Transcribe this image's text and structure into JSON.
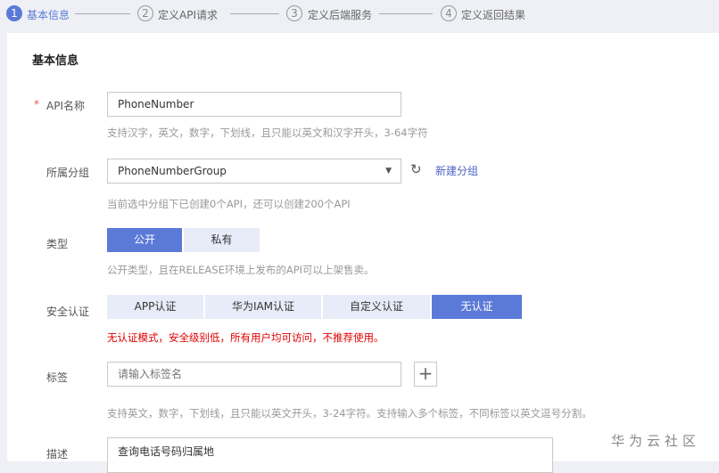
{
  "steps": [
    {
      "num": "1",
      "label": "基本信息"
    },
    {
      "num": "2",
      "label": "定义API请求"
    },
    {
      "num": "3",
      "label": "定义后端服务"
    },
    {
      "num": "4",
      "label": "定义返回结果"
    }
  ],
  "section_title": "基本信息",
  "api_name": {
    "required": "*",
    "label": "API名称",
    "value": "PhoneNumber",
    "hint": "支持汉字，英文，数字，下划线，且只能以英文和汉字开头，3-64字符"
  },
  "group": {
    "label": "所属分组",
    "value": "PhoneNumberGroup",
    "new_link": "新建分组",
    "hint": "当前选中分组下已创建0个API，还可以创建200个API"
  },
  "type": {
    "label": "类型",
    "options": [
      "公开",
      "私有"
    ],
    "selected": "公开",
    "hint": "公开类型，且在RELEASE环境上发布的API可以上架售卖。"
  },
  "auth": {
    "label": "安全认证",
    "options": [
      "APP认证",
      "华为IAM认证",
      "自定义认证",
      "无认证"
    ],
    "selected": "无认证",
    "warning": "无认证模式，安全级别低，所有用户均可访问，不推荐使用。"
  },
  "tags": {
    "label": "标签",
    "placeholder": "请输入标签名",
    "hint": "支持英文，数字，下划线，且只能以英文开头，3-24字符。支持输入多个标签，不同标签以英文逗号分割。"
  },
  "description": {
    "label": "描述",
    "value": "查询电话号码归属地"
  },
  "watermark": "华为云社区",
  "colors": {
    "accent": "#5b7ad8",
    "warning": "#e00000"
  }
}
